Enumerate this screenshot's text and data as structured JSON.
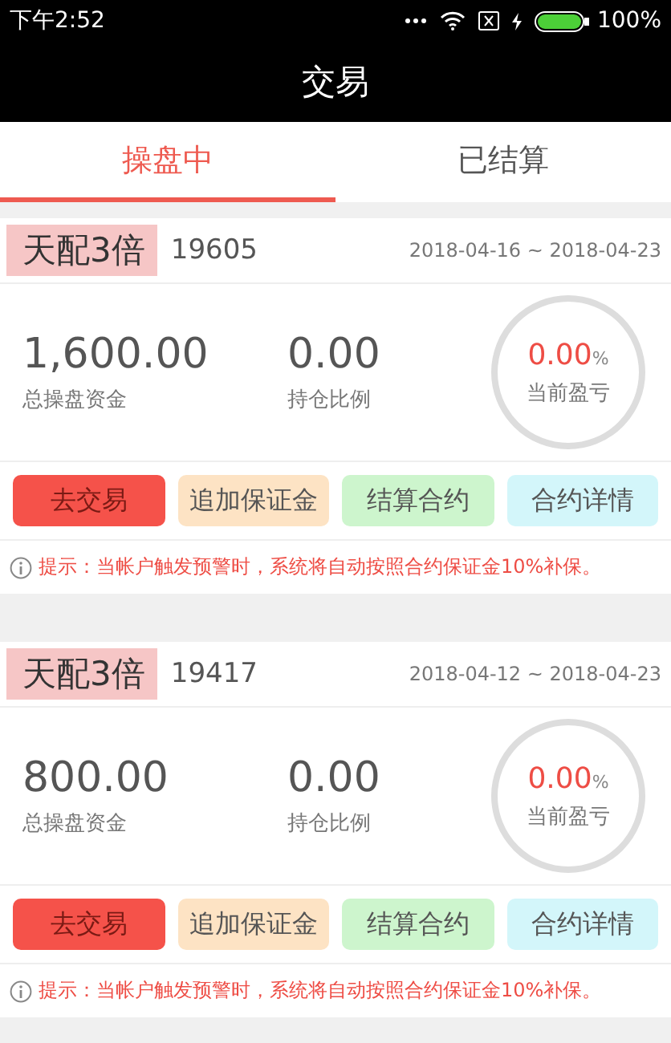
{
  "status_bar": {
    "time": "下午2:52",
    "battery": "100%"
  },
  "header": {
    "title": "交易"
  },
  "tabs": [
    {
      "label": "操盘中",
      "selected": true
    },
    {
      "label": "已结算",
      "selected": false
    }
  ],
  "contracts": [
    {
      "tag": "天配3倍",
      "number": "19605",
      "dates": "2018-04-16 ~ 2018-04-23",
      "total": "1,600.00",
      "total_label": "总操盘资金",
      "ratio": "0.00",
      "ratio_label": "持仓比例",
      "profit": "0.00",
      "profit_unit": "%",
      "profit_label": "当前盈亏",
      "buttons": [
        {
          "label": "去交易",
          "kind": "trade"
        },
        {
          "label": "追加保证金",
          "kind": "margin"
        },
        {
          "label": "结算合约",
          "kind": "settle"
        },
        {
          "label": "合约详情",
          "kind": "detail"
        }
      ],
      "notice": "提示：当帐户触发预警时，系统将自动按照合约保证金10%补保。"
    },
    {
      "tag": "天配3倍",
      "number": "19417",
      "dates": "2018-04-12 ~ 2018-04-23",
      "total": "800.00",
      "total_label": "总操盘资金",
      "ratio": "0.00",
      "ratio_label": "持仓比例",
      "profit": "0.00",
      "profit_unit": "%",
      "profit_label": "当前盈亏",
      "buttons": [
        {
          "label": "去交易",
          "kind": "trade"
        },
        {
          "label": "追加保证金",
          "kind": "margin"
        },
        {
          "label": "结算合约",
          "kind": "settle"
        },
        {
          "label": "合约详情",
          "kind": "detail"
        }
      ],
      "notice": "提示：当帐户触发预警时，系统将自动按照合约保证金10%补保。"
    }
  ]
}
